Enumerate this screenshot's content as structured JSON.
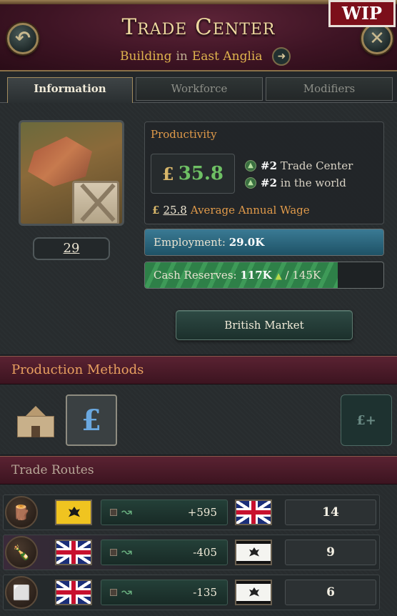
{
  "header": {
    "title": "Trade Center",
    "subtitle_type": "Building",
    "subtitle_in": "in",
    "subtitle_location": "East Anglia",
    "wip_label": "WIP",
    "back_icon": "↶",
    "close_icon": "✕",
    "goto_icon": "➜"
  },
  "tabs": [
    "Information",
    "Workforce",
    "Modifiers"
  ],
  "info": {
    "level": "29",
    "productivity_label": "Productivity",
    "currency": "£",
    "productivity_value": "35.8",
    "rank1_num": "#2",
    "rank1_text": "Trade Center",
    "rank2_num": "#2",
    "rank2_text": "in the world",
    "wage_value": "25.8",
    "wage_label": "Average Annual Wage",
    "employment_label": "Employment:",
    "employment_value": "29.0K",
    "employment_fill": 1.0,
    "cash_label": "Cash Reserves:",
    "cash_value": "117K",
    "cash_max": "/ 145K",
    "cash_fill": 0.807,
    "market_button": "British Market"
  },
  "production_methods": {
    "title": "Production Methods",
    "selected_icon": "£",
    "add_icon": "£+"
  },
  "trade_routes": {
    "title": "Trade Routes",
    "rows": [
      {
        "goods": "wood",
        "from_flag": "austria",
        "amount": "+595",
        "to_flag": "uk",
        "count": "14",
        "highlight": false
      },
      {
        "goods": "liquor",
        "from_flag": "uk",
        "amount": "-405",
        "to_flag": "prussia",
        "count": "9",
        "highlight": true
      },
      {
        "goods": "iron",
        "from_flag": "uk",
        "amount": "-135",
        "to_flag": "prussia",
        "count": "6",
        "highlight": false
      }
    ]
  },
  "colors": {
    "productivity_green": "#6ec064",
    "label_orange": "#e09a4a",
    "header_maroon": "#4a1a2c",
    "employment_blue": "#2e6a82",
    "cash_green": "#3a9052"
  }
}
